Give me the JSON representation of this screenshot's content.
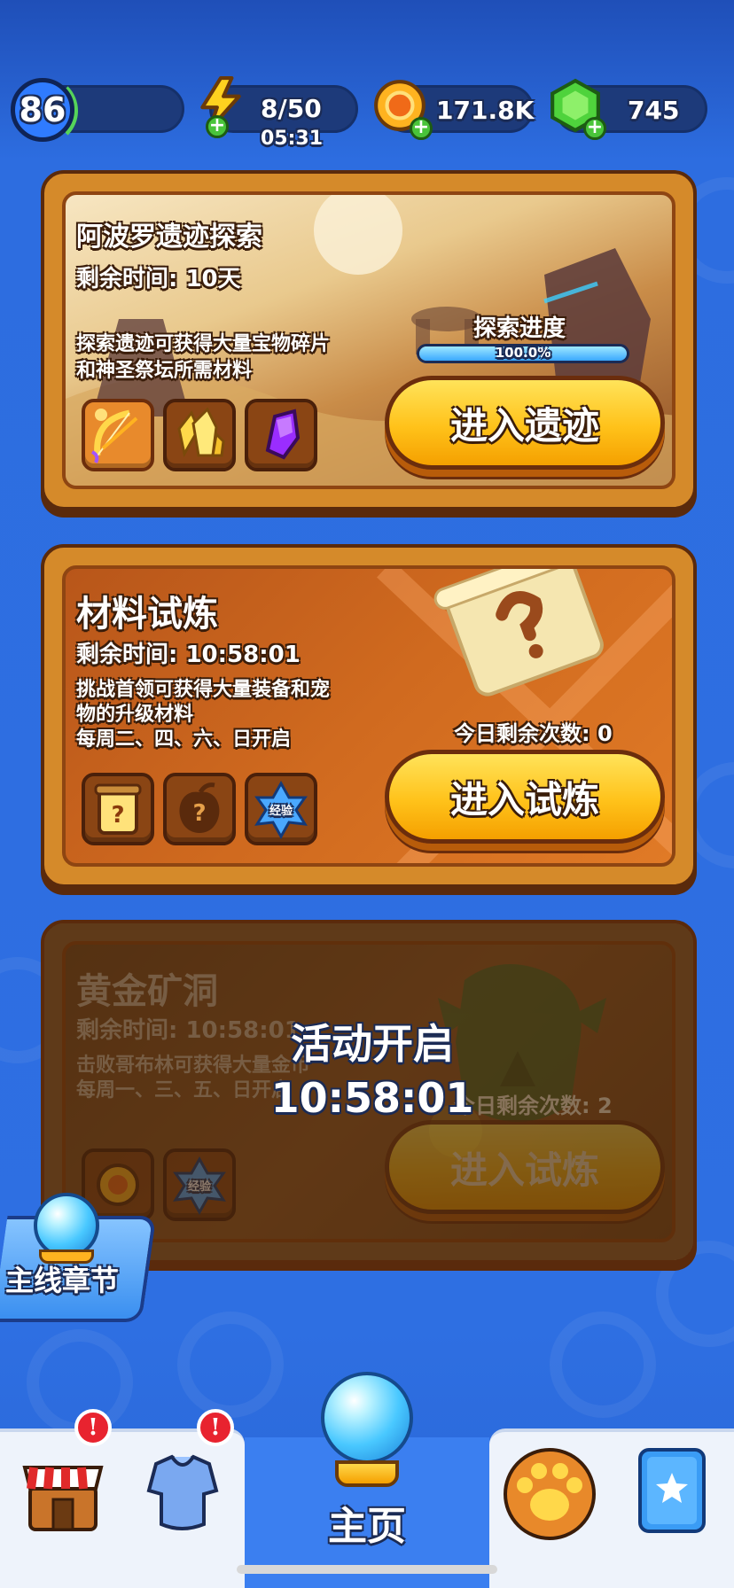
{
  "top_bar": {
    "level": "86",
    "energy": {
      "value": "8/50",
      "timer": "05:31"
    },
    "coins": {
      "value": "171.8K"
    },
    "gems": {
      "value": "745"
    }
  },
  "events": [
    {
      "title": "阿波罗遗迹探索",
      "time_remaining": "剩余时间: 10天",
      "description": [
        "探索遗迹可获得大量宝物碎片",
        "和神圣祭坛所需材料"
      ],
      "progress_label": "探索进度",
      "progress_text": "100.0%",
      "progress_fraction": 1.0,
      "button_label": "进入遗迹",
      "rewards": [
        "golden-bow-icon",
        "yellow-crystal-icon",
        "purple-gem-icon"
      ]
    },
    {
      "title": "材料试炼",
      "time_remaining": "剩余时间: 10:58:01",
      "description": [
        "挑战首领可获得大量装备和宠",
        "物的升级材料",
        "每周二、四、六、日开启"
      ],
      "attempts_label": "今日剩余次数: 0",
      "button_label": "进入试炼",
      "rewards": [
        {
          "icon": "mystery-jar-icon"
        },
        {
          "icon": "mystery-fruit-icon"
        },
        {
          "icon": "exp-star-icon",
          "label": "经验"
        }
      ]
    },
    {
      "title": "黄金矿洞",
      "time_remaining": "剩余时间: 10:58:01",
      "description": [
        "击败哥布林可获得大量金币",
        "每周一、三、五、日开启"
      ],
      "attempts_label": "今日剩余次数: 2",
      "button_label": "进入试炼",
      "rewards": [
        {
          "icon": "coin-icon"
        },
        {
          "icon": "exp-star-icon",
          "label": "经验"
        }
      ],
      "locked_overlay": {
        "line1": "活动开启",
        "line2": "10:58:01"
      }
    }
  ],
  "side_button": {
    "label": "主线章节"
  },
  "bottom_nav": {
    "home_label": "主页",
    "items": [
      "shop-icon",
      "armor-icon",
      "home-orb-icon",
      "paw-icon",
      "star-card-icon"
    ]
  },
  "colors": {
    "background": "#2f6fe0",
    "button_yellow": "#ffc21a",
    "card_orange": "#d58a2a"
  }
}
